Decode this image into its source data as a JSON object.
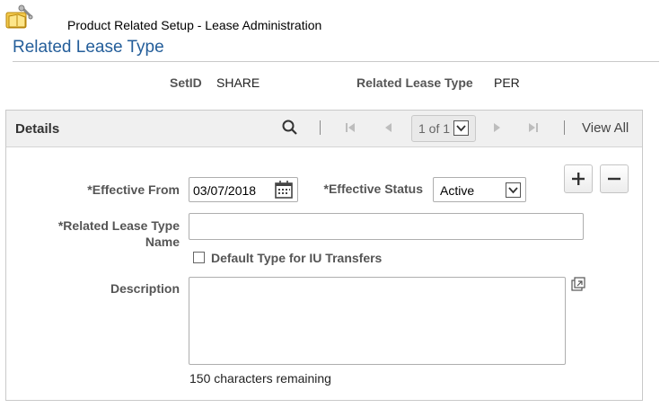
{
  "header": {
    "breadcrumb": "Product Related Setup - Lease Administration",
    "title": "Related Lease Type"
  },
  "keys": {
    "setid_label": "SetID",
    "setid_value": "SHARE",
    "type_label": "Related Lease Type",
    "type_value": "PER"
  },
  "details": {
    "title": "Details",
    "pager": "1 of 1",
    "view_all": "View All"
  },
  "form": {
    "effective_from_label": "*Effective From",
    "effective_from_value": "03/07/2018",
    "effective_status_label": "*Effective Status",
    "effective_status_value": "Active",
    "name_label_line1": "*Related Lease Type",
    "name_label_line2": "Name",
    "name_value": "",
    "default_type_label": "Default Type for IU Transfers",
    "description_label": "Description",
    "description_value": "",
    "chars_remaining": "150 characters remaining"
  },
  "icons": {
    "app": "folder-book-icon",
    "search": "search-icon",
    "first": "first-page-icon",
    "prev": "previous-icon",
    "next": "next-icon",
    "last": "last-page-icon",
    "calendar": "calendar-icon",
    "add": "plus-icon",
    "remove": "minus-icon",
    "expand": "expand-popup-icon"
  },
  "colors": {
    "title": "#245e9a",
    "label": "#555555",
    "bar": "#f0f0f0"
  }
}
